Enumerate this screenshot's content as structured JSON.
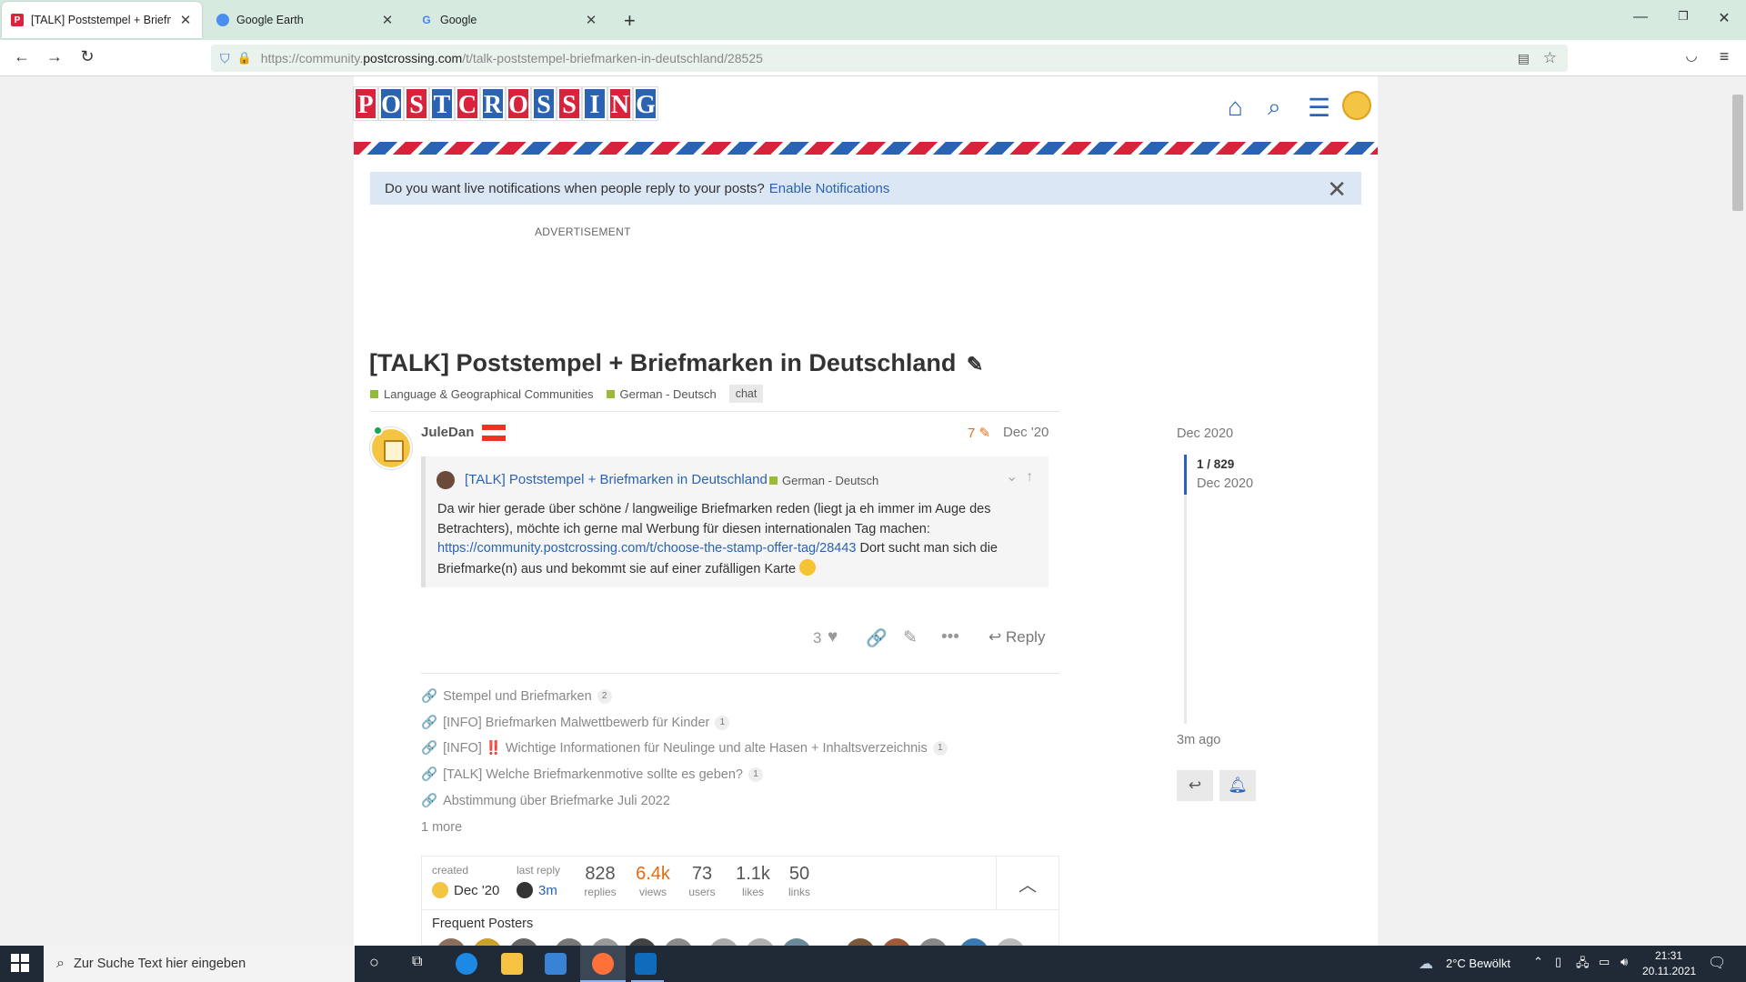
{
  "browser": {
    "tabs": [
      {
        "title": "[TALK] Poststempel + Briefmark",
        "fav": "P",
        "fav_color": "#d9223c"
      },
      {
        "title": "Google Earth",
        "fav": "",
        "fav_color": "#4a8ef0"
      },
      {
        "title": "Google",
        "fav": "G",
        "fav_color": "#ffffff"
      }
    ],
    "url_prefix": "https://community.",
    "url_domain": "postcrossing.com",
    "url_path": "/t/talk-poststempel-briefmarken-in-deutschland/28525"
  },
  "site": {
    "logo_letters": [
      "P",
      "O",
      "S",
      "T",
      "C",
      "R",
      "O",
      "S",
      "S",
      "I",
      "N",
      "G"
    ],
    "logo_colors": [
      "#d9223c",
      "#2a63b4",
      "#d9223c",
      "#2a63b4",
      "#d9223c",
      "#2a63b4",
      "#d9223c",
      "#2a63b4",
      "#d9223c",
      "#2a63b4",
      "#d9223c",
      "#2a63b4"
    ]
  },
  "notification": {
    "text": "Do you want live notifications when people reply to your posts?",
    "link": "Enable Notifications"
  },
  "ad_label": "ADVERTISEMENT",
  "topic": {
    "title": "[TALK] Poststempel + Briefmarken in Deutschland",
    "category": "Language & Geographical Communities",
    "category_color": "#8fbc3f",
    "subcategory": "German - Deutsch",
    "subcategory_color": "#9cba38",
    "tag": "chat"
  },
  "post": {
    "username": "JuleDan",
    "edits": "7",
    "date": "Dec '20",
    "quote_title": "[TALK] Poststempel + Briefmarken in Deutschland",
    "quote_category": "German - Deutsch",
    "quote_line1": "Da wir hier gerade über schöne / langweilige Briefmarken reden (liegt ja eh immer im Auge des",
    "quote_line2": "Betrachters), möchte ich gerne mal Werbung für diesen internationalen Tag machen:",
    "quote_link": "https://community.postcrossing.com/t/choose-the-stamp-offer-tag/28443",
    "quote_line3": " Dort sucht man sich die",
    "quote_line4": "Briefmarke(n) aus und bekommt sie auf einer zufälligen Karte",
    "likes": "3",
    "reply_label": "Reply"
  },
  "links": [
    {
      "text": "Stempel und Briefmarken",
      "count": "2"
    },
    {
      "text": "[INFO] Briefmarken Malwettbewerb für Kinder",
      "count": "1"
    },
    {
      "text": "[INFO] ‼️ Wichtige Informationen für Neulinge und alte Hasen + Inhaltsverzeichnis",
      "count": "1"
    },
    {
      "text": "[TALK] Welche Briefmarkenmotive sollte es geben?",
      "count": "1"
    },
    {
      "text": "Abstimmung über Briefmarke Juli 2022",
      "count": ""
    }
  ],
  "more_label": "1 more",
  "stats": {
    "created_label": "created",
    "created": "Dec '20",
    "last_label": "last reply",
    "last": "3m",
    "replies": "828",
    "replies_label": "replies",
    "views": "6.4k",
    "views_label": "views",
    "users": "73",
    "users_label": "users",
    "likes": "1.1k",
    "likes_label": "likes",
    "links": "50",
    "links_label": "links",
    "frequent_label": "Frequent Posters"
  },
  "timeline": {
    "top": "Dec 2020",
    "position": "1 / 829",
    "position_date": "Dec 2020",
    "bottom": "3m ago"
  },
  "taskbar": {
    "search_placeholder": "Zur Suche Text hier eingeben",
    "weather": "2°C  Bewölkt",
    "time": "21:31",
    "date": "20.11.2021"
  }
}
